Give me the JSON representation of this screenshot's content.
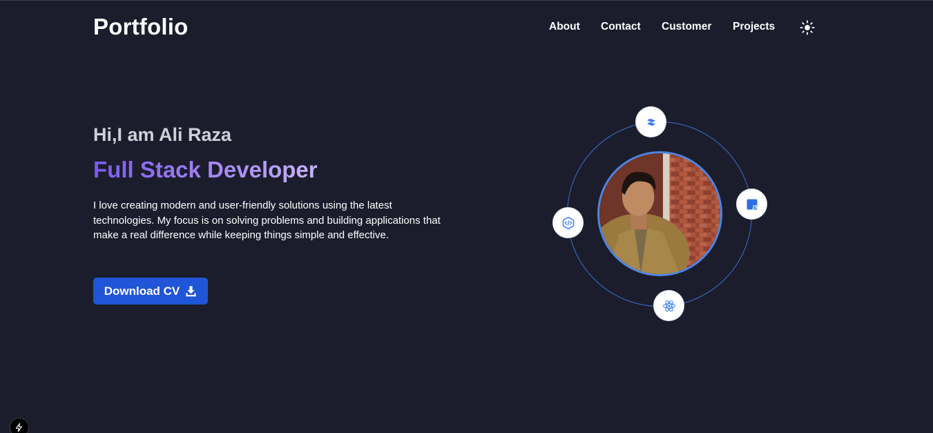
{
  "header": {
    "logo": "Portfolio",
    "nav": [
      "About",
      "Contact",
      "Customer",
      "Projects"
    ],
    "theme_toggle_icon": "sun-icon"
  },
  "hero": {
    "greeting": "Hi,I am Ali Raza",
    "role": "Full Stack Developer",
    "bio": "I love creating modern and user-friendly solutions using the latest technologies. My focus is on solving problems and building applications that make a real difference while keeping things simple and effective.",
    "cv_button": "Download CV",
    "cv_icon": "download-icon"
  },
  "orbit": {
    "badges": [
      "tailwind-icon",
      "javascript-icon",
      "code-editor-icon",
      "react-icon"
    ],
    "photo": "profile-photo"
  },
  "colors": {
    "background": "#1b1d2c",
    "accent": "#1f55d6",
    "role_gradient": [
      "#7b5af0",
      "#c7b4f7"
    ],
    "orbit_ring": "#3c6fd0"
  }
}
